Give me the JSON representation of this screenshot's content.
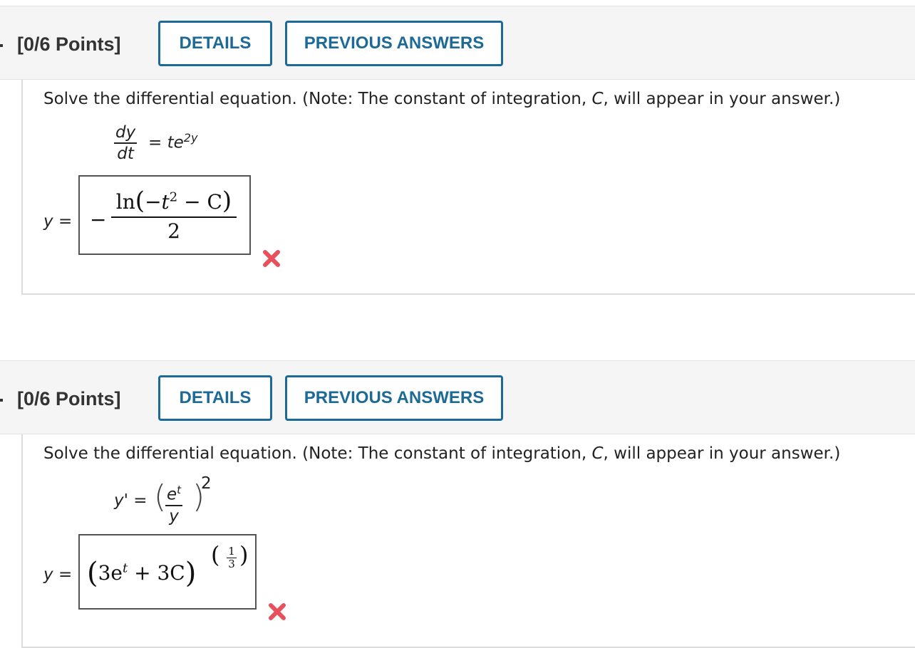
{
  "questions": [
    {
      "points": "[0/6 Points]",
      "details_label": "DETAILS",
      "previous_label": "PREVIOUS ANSWERS",
      "prompt_before": "Solve the differential equation. (Note: The constant of integration, ",
      "prompt_var": "C",
      "prompt_after": ", will appear in your answer.)",
      "equation": {
        "lhs_num": "dy",
        "lhs_den": "dt",
        "eq": "=",
        "rhs_base": "te",
        "rhs_exp": "2y"
      },
      "answer_lhs": "y",
      "answer_eq": "=",
      "answer": {
        "neg": "−",
        "ln": "ln",
        "inner": "−t",
        "inner_exp": "2",
        "minus_c": " − C",
        "den": "2"
      },
      "status": "incorrect"
    },
    {
      "points": "[0/6 Points]",
      "details_label": "DETAILS",
      "previous_label": "PREVIOUS ANSWERS",
      "prompt_before": "Solve the differential equation. (Note: The constant of integration, ",
      "prompt_var": "C",
      "prompt_after": ", will appear in your answer.)",
      "equation": {
        "lhs": "y'",
        "eq": "=",
        "num": "e",
        "num_exp": "t",
        "den": "y",
        "outer_exp": "2"
      },
      "answer_lhs": "y",
      "answer_eq": "=",
      "answer": {
        "body": "3e",
        "body_exp": "t",
        "rest": " + 3C",
        "exp_num": "1",
        "exp_den": "3"
      },
      "status": "incorrect"
    }
  ],
  "colors": {
    "accent": "#1d6a96",
    "error": "#e8505b",
    "header_bg": "#f5f5f5"
  },
  "icons": {
    "incorrect": "x-mark-icon"
  }
}
